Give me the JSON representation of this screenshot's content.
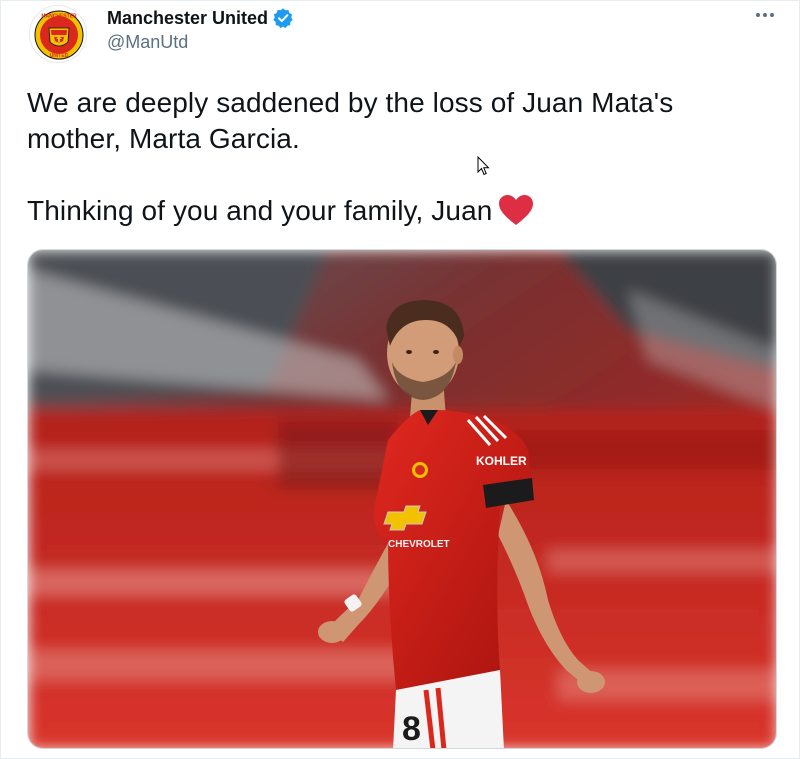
{
  "account": {
    "display_name": "Manchester United",
    "handle": "@ManUtd",
    "verified": true,
    "avatar_icon": "manchester-united-crest-icon",
    "avatar_crest_text_top": "MANCHESTER",
    "avatar_crest_text_bottom": "UNITED"
  },
  "menu": {
    "icon": "more-options-icon"
  },
  "tweet": {
    "line1": "We are deeply saddened by the loss of Juan Mata's\nmother, Marta Garcia.",
    "line2": "Thinking of you and your family, Juan",
    "emoji": "red-heart-icon"
  },
  "media": {
    "shirt_sponsor_sleeve": "KOHLER",
    "shirt_sponsor_chest": "CHEVROLET",
    "shirt_number": "8"
  },
  "colors": {
    "text_primary": "#0f1419",
    "text_secondary": "#5b7083",
    "verified_blue": "#1d9bf0",
    "heart_red": "#dd2e44",
    "united_red": "#da291c"
  }
}
